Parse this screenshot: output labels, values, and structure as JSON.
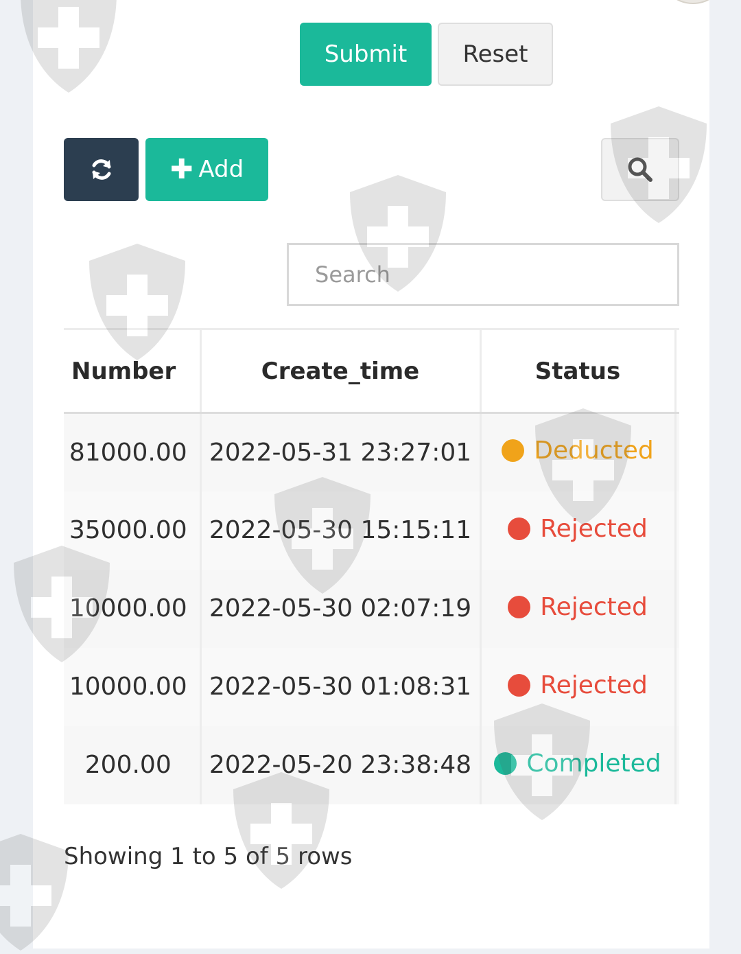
{
  "form": {
    "submit_label": "Submit",
    "reset_label": "Reset"
  },
  "toolbar": {
    "refresh_icon": "refresh-icon",
    "add_label": "Add",
    "add_icon": "plus-icon",
    "search_icon": "search-icon"
  },
  "search": {
    "placeholder": "Search"
  },
  "table": {
    "headers": {
      "number": "Number",
      "create_time": "Create_time",
      "status": "Status"
    },
    "rows": [
      {
        "number": "81000.00",
        "create_time": "2022-05-31 23:27:01",
        "status": "Deducted",
        "status_color": "#f0a31a"
      },
      {
        "number": "35000.00",
        "create_time": "2022-05-30 15:15:11",
        "status": "Rejected",
        "status_color": "#e74c3c"
      },
      {
        "number": "10000.00",
        "create_time": "2022-05-30 02:07:19",
        "status": "Rejected",
        "status_color": "#e74c3c"
      },
      {
        "number": "10000.00",
        "create_time": "2022-05-30 01:08:31",
        "status": "Rejected",
        "status_color": "#e74c3c"
      },
      {
        "number": "200.00",
        "create_time": "2022-05-20 23:38:48",
        "status": "Completed",
        "status_color": "#1bb99a"
      }
    ]
  },
  "footer": {
    "pagination_info": "Showing 1 to 5 of 5 rows"
  },
  "colors": {
    "primary": "#1bb99a",
    "dark": "#2c3e50"
  }
}
